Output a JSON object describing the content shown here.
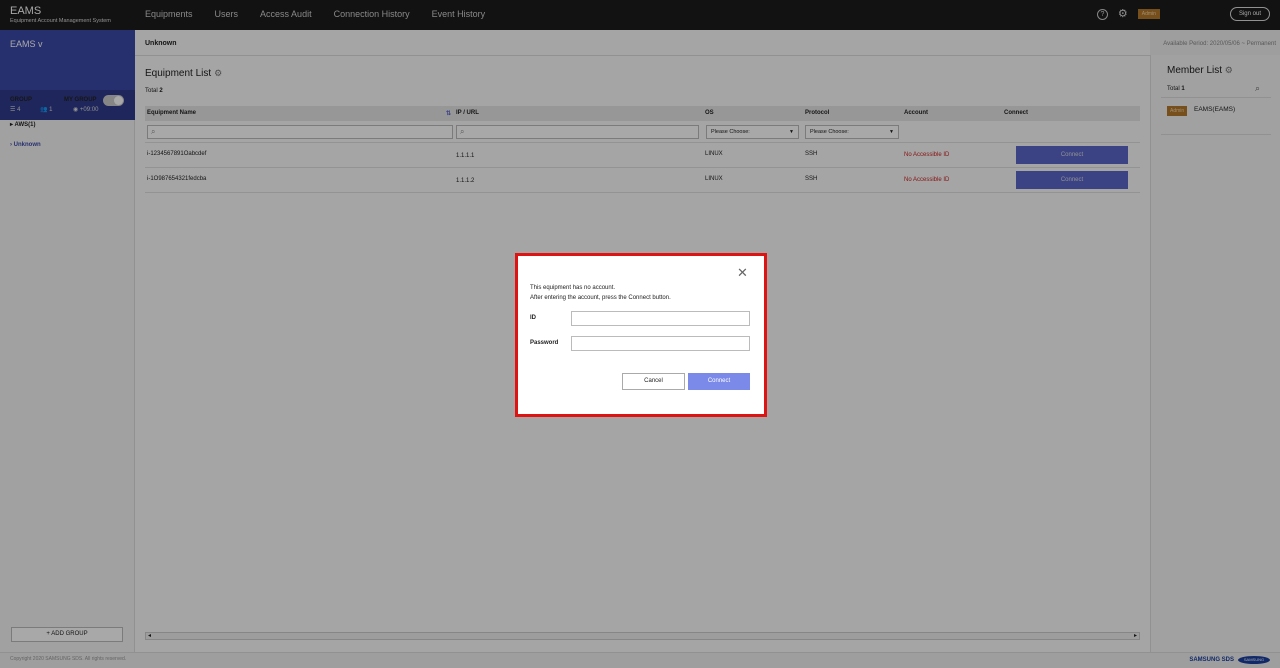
{
  "app": {
    "name": "EAMS",
    "subtitle": "Equipment Account Management System"
  },
  "nav": [
    "Equipments",
    "Users",
    "Access Audit",
    "Connection History",
    "Event History"
  ],
  "topbar": {
    "help_icon": "?",
    "admin_badge": "Admin",
    "signout": "Sign out"
  },
  "sidebar": {
    "title": "EAMS v",
    "stats": {
      "groups": "4",
      "members": "1",
      "timezone": "+09:00"
    },
    "tabs": {
      "group": "GROUP",
      "my_group": "MY GROUP"
    },
    "tree": [
      "AWS(1)",
      "Unknown"
    ],
    "add_group": "ADD GROUP"
  },
  "main": {
    "breadcrumb": "Unknown",
    "period": "Available Period: 2020/05/06 ~ Permanent",
    "title": "Equipment List",
    "total_label": "Total",
    "total_value": "2",
    "columns": [
      "Equipment Name",
      "IP / URL",
      "OS",
      "Protocol",
      "Account",
      "Connect"
    ],
    "select_placeholder": "Please Choose:",
    "rows": [
      {
        "name": "i-1234567891Oabcdef",
        "ip": "1.1.1.1",
        "os": "LINUX",
        "protocol": "SSH",
        "account": "No Accessible ID",
        "connect": "Connect"
      },
      {
        "name": "i-1O987654321fedcba",
        "ip": "1.1.1.2",
        "os": "LINUX",
        "protocol": "SSH",
        "account": "No Accessible ID",
        "connect": "Connect"
      }
    ]
  },
  "member_panel": {
    "title": "Member List",
    "total_label": "Total",
    "total_value": "1",
    "members": [
      {
        "role": "Admin",
        "name": "EAMS(EAMS)"
      }
    ]
  },
  "footer": {
    "copyright": "Copyright 2020 SAMSUNG SDS. All rights reserved.",
    "sds": "SAMSUNG SDS",
    "samsung": "SAMSUNG"
  },
  "modal": {
    "message_line1": "This equipment has no account.",
    "message_line2": "After entering the account, press the Connect button.",
    "id_label": "ID",
    "id_value": "",
    "password_label": "Password",
    "password_value": "",
    "cancel": "Cancel",
    "connect": "Connect",
    "colors": {
      "highlight_border": "#e01313",
      "primary": "#7b8ae8"
    }
  }
}
